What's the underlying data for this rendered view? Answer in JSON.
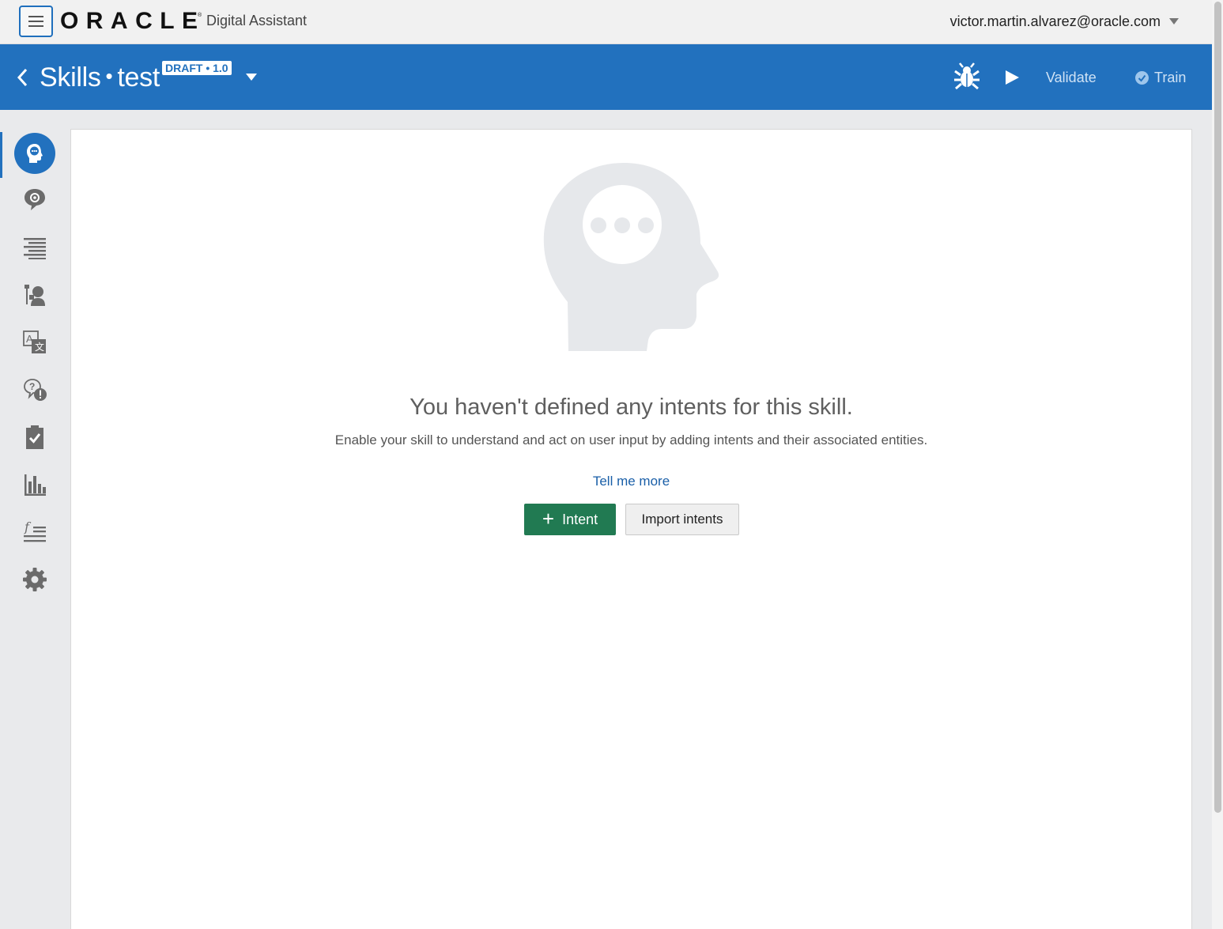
{
  "topbar": {
    "brand": "ORACLE",
    "product": "Digital Assistant",
    "user_email": "victor.martin.alvarez@oracle.com"
  },
  "header": {
    "section": "Skills",
    "separator": "•",
    "skill_name": "test",
    "version_badge": "DRAFT • 1.0",
    "validate_label": "Validate",
    "train_label": "Train"
  },
  "sidebar": {
    "items": [
      {
        "name": "intents",
        "icon": "head-chat-icon",
        "active": true
      },
      {
        "name": "entities",
        "icon": "chat-gear-icon"
      },
      {
        "name": "flows",
        "icon": "text-lines-icon"
      },
      {
        "name": "components",
        "icon": "tools-person-icon"
      },
      {
        "name": "resource-bundles",
        "icon": "translate-icon"
      },
      {
        "name": "quality",
        "icon": "question-alert-icon"
      },
      {
        "name": "tests",
        "icon": "clipboard-check-icon"
      },
      {
        "name": "insights",
        "icon": "bar-chart-icon"
      },
      {
        "name": "settings-functions",
        "icon": "function-lines-icon"
      },
      {
        "name": "settings",
        "icon": "gear-icon"
      }
    ]
  },
  "main": {
    "empty_title": "You haven't defined any intents for this skill.",
    "empty_description": "Enable your skill to understand and act on user input by adding intents and their associated entities.",
    "tell_more_link": "Tell me more",
    "add_intent_label": "Intent",
    "import_label": "Import intents"
  },
  "colors": {
    "header_blue": "#2271be",
    "primary_green": "#217a52",
    "link_blue": "#1a5fa8",
    "icon_gray": "#6b6b6b",
    "illustration_gray": "#e6e8eb"
  }
}
